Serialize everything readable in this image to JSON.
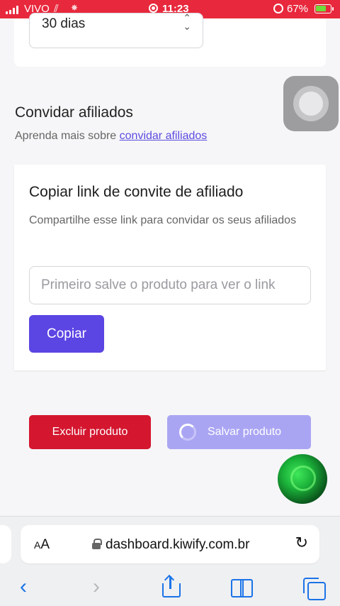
{
  "status_bar": {
    "carrier": "VIVO",
    "time": "11:23",
    "battery": "67%",
    "colors": {
      "background": "#e8283c"
    }
  },
  "period_select": {
    "value": "30 dias"
  },
  "affiliates": {
    "title": "Convidar afiliados",
    "subtitle_prefix": "Aprenda mais sobre",
    "subtitle_link": "convidar afiliados"
  },
  "invite_card": {
    "title": "Copiar link de convite de afiliado",
    "description": "Compartilhe esse link para convidar os seus afiliados",
    "link_placeholder": "Primeiro salve o produto para ver o link",
    "copy_label": "Copiar"
  },
  "actions": {
    "delete_label": "Excluir produto",
    "save_label": "Salvar produto",
    "colors": {
      "delete": "#d4162f",
      "save": "#aaa5f3",
      "accent": "#5b45e3"
    }
  },
  "browser": {
    "text_size_label": "AA",
    "url": "dashboard.kiwify.com.br",
    "icons": [
      "lock-icon",
      "reload-icon",
      "back-icon",
      "forward-icon",
      "share-icon",
      "bookmarks-icon",
      "tabs-icon"
    ]
  }
}
